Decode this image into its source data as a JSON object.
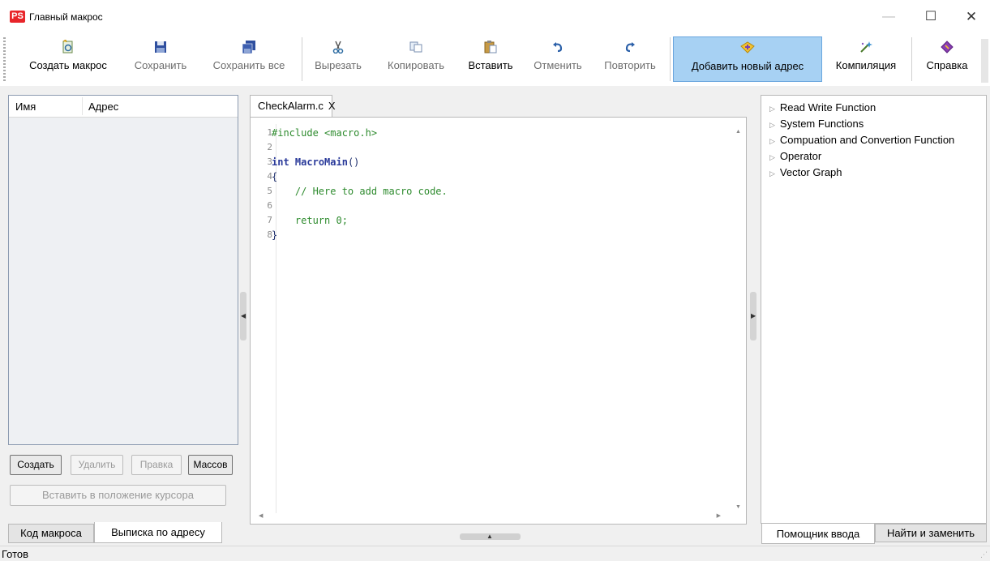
{
  "window": {
    "app_icon_text": "PS",
    "title": "Главный макрос",
    "minimize": "—",
    "maximize": "☐",
    "close": "✕"
  },
  "toolbar": {
    "create_macro": "Создать макрос",
    "save": "Сохранить",
    "save_all": "Сохранить все",
    "cut": "Вырезать",
    "copy": "Копировать",
    "paste": "Вставить",
    "undo": "Отменить",
    "redo": "Повторить",
    "add_new_address": "Добавить новый адрес",
    "compile": "Компиляция",
    "help": "Справка"
  },
  "left_panel": {
    "columns": [
      "Имя",
      "Адрес"
    ],
    "buttons": {
      "create": "Создать",
      "delete": "Удалить",
      "edit": "Правка",
      "mass": "Массов"
    },
    "insert_at_cursor": "Вставить в положение курсора",
    "tabs": [
      "Код макроса",
      "Выписка по адресу"
    ]
  },
  "editor": {
    "tab_label": "CheckAlarm.c",
    "tab_close": "X",
    "line_numbers": [
      "1",
      "2",
      "3",
      "4",
      "5",
      "6",
      "7",
      "8"
    ],
    "code": {
      "l1": "#include <macro.h>",
      "l3_kw": "int",
      "l3_fn": "MacroMain",
      "l3_paren": "()",
      "l4": "{",
      "l5": "    // Here to add macro code.",
      "l7_ret": "    return 0;",
      "l8": "}"
    }
  },
  "right_panel": {
    "tree": [
      "Read Write Function",
      "System Functions",
      "Compuation and Convertion Function",
      "Operator",
      "Vector Graph"
    ],
    "tabs": [
      "Помощник ввода",
      "Найти и заменить"
    ]
  },
  "status": {
    "text": "Готов"
  }
}
